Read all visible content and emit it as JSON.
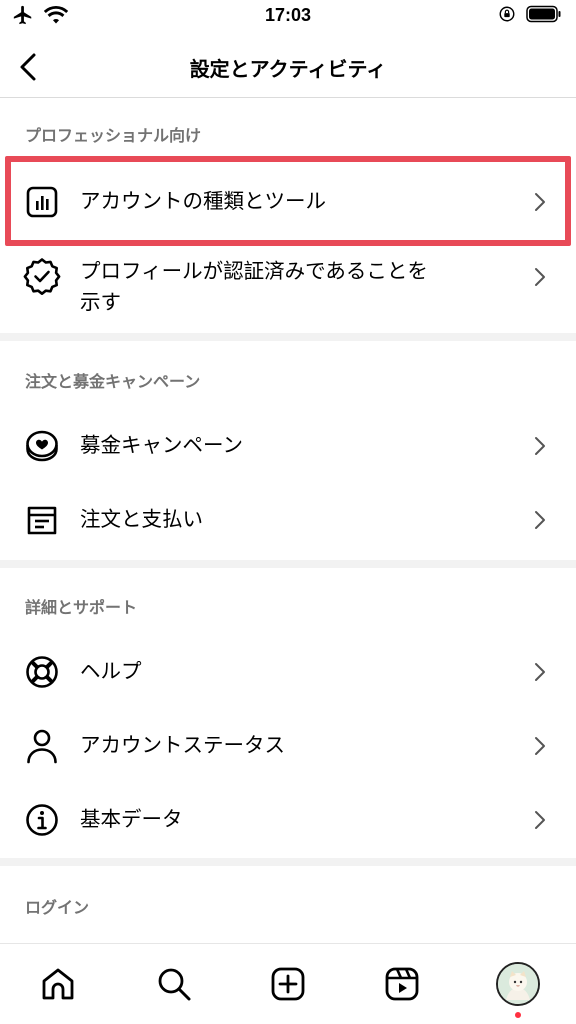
{
  "status_bar": {
    "time": "17:03",
    "left_icons": [
      "airplane-icon",
      "wifi-icon"
    ],
    "right_icons": [
      "orientation-lock-icon",
      "battery-icon"
    ]
  },
  "nav": {
    "title": "設定とアクティビティ",
    "back_icon": "chevron-left-icon"
  },
  "sections": [
    {
      "header": "プロフェッショナル向け",
      "items": [
        {
          "label": "アカウントの種類とツール",
          "icon": "bar-chart-icon"
        },
        {
          "label_line1": "プロフィールが認証済みであることを",
          "label_line2": "示す",
          "icon": "verified-badge-icon"
        }
      ]
    },
    {
      "header": "注文と募金キャンペーン",
      "items": [
        {
          "label": "募金キャンペーン",
          "icon": "heart-coin-icon"
        },
        {
          "label": "注文と支払い",
          "icon": "receipt-icon"
        }
      ]
    },
    {
      "header": "詳細とサポート",
      "items": [
        {
          "label": "ヘルプ",
          "icon": "lifebuoy-icon"
        },
        {
          "label": "アカウントステータス",
          "icon": "person-icon"
        },
        {
          "label": "基本データ",
          "icon": "info-icon"
        }
      ]
    },
    {
      "header": "ログイン",
      "items": []
    }
  ],
  "tab_bar": {
    "tabs": [
      "home-icon",
      "search-icon",
      "create-icon",
      "reels-icon",
      "profile-avatar"
    ],
    "notification_dot_color": "#ff3040"
  },
  "colors": {
    "highlight": "#e84a57",
    "section_header": "#737373",
    "divider": "#f2f2f2"
  }
}
